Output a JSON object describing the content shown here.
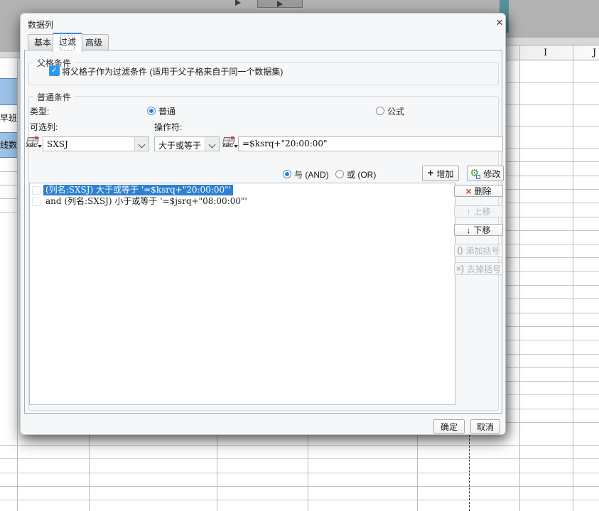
{
  "app": {
    "column_headers": [
      "I",
      "J"
    ],
    "left_cells": [
      "早班",
      "线数"
    ],
    "toolbar": {
      "run_icon": "play-icon"
    }
  },
  "dialog": {
    "title": "数据列",
    "close_icon": "×",
    "tabs": [
      {
        "label": "基本",
        "selected": false
      },
      {
        "label": "过滤",
        "selected": true
      },
      {
        "label": "高级",
        "selected": false
      }
    ],
    "parent_section": {
      "title": "父格条件",
      "checkbox_checked": true,
      "check_glyph": "✓",
      "checkbox_label": "将父格子作为过滤条件 (适用于父子格来自于同一个数据集)"
    },
    "normal_section": {
      "title": "普通条件",
      "type_label": "类型:",
      "radio_normal": "普通",
      "radio_formula": "公式",
      "type_selected": "普通",
      "column_label": "可选列:",
      "operator_label": "操作符:",
      "column_value": "SXSJ",
      "operator_value": "大于或等于",
      "value_input": "=$ksrq+\"20:00:00\"",
      "and_label": "与 (AND)",
      "or_label": "或 (OR)",
      "logic_selected": "与 (AND)",
      "add_button": "增加",
      "add_icon": "+",
      "modify_button": "修改",
      "conditions": [
        {
          "text": "(列名:SXSJ) 大于或等于 '=$ksrq+\"20:00:00\"'",
          "selected": true
        },
        {
          "text": "and (列名:SXSJ) 小于或等于 '=$jsrq+\"08:00:00\"'",
          "selected": false
        }
      ],
      "side_buttons": [
        {
          "label": "删除",
          "icon": "×",
          "enabled": true
        },
        {
          "label": "上移",
          "icon": "↑",
          "enabled": false
        },
        {
          "label": "下移",
          "icon": "↓",
          "enabled": true
        },
        {
          "label": "添加括号",
          "icon": "()",
          "enabled": false
        },
        {
          "label": "去掉括号",
          "icon": "×)",
          "enabled": false
        }
      ]
    },
    "ok_button": "确定",
    "cancel_button": "取消"
  },
  "colors": {
    "accent_blue": "#2f80d0",
    "checkbox_blue": "#2b98f0",
    "delete_red": "#df3526",
    "gear_green": "#3f9b2f",
    "selection_cell_blue": "#9cc3e9"
  }
}
